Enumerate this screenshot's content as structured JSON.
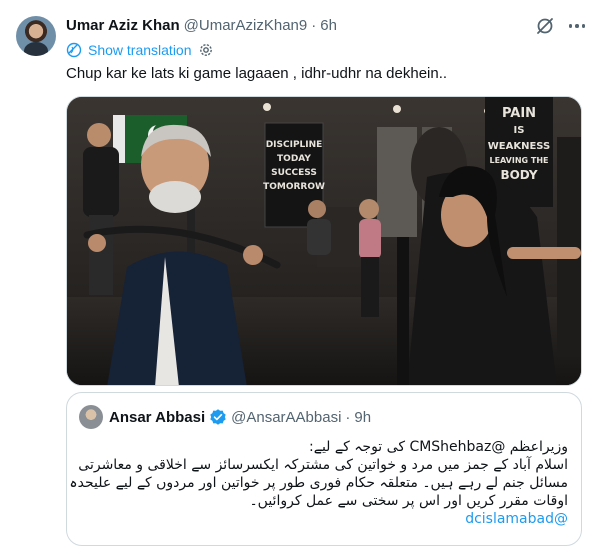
{
  "tweet": {
    "author_name": "Umar Aziz Khan",
    "author_handle": "@UmarAzizKhan9",
    "separator": "·",
    "time": "6h",
    "show_translation": "Show translation",
    "text": "Chup kar ke lats ki game lagaaen , idhr-udhr na dekhein.."
  },
  "media": {
    "sign_left": [
      "DISCIPLINE",
      "TODAY",
      "SUCCESS",
      "TOMORROW"
    ],
    "sign_right": [
      "PAIN",
      "IS",
      "WEAKNESS",
      "LEAVING THE",
      "BODY"
    ]
  },
  "quote": {
    "author_name": "Ansar Abbasi",
    "author_handle": "@AnsarAAbbasi",
    "separator": "·",
    "time": "9h",
    "lines": [
      "وزیراعظم @CMShehbaz کی توجہ کے لیے:",
      "اسلام آباد کے جمز میں مرد و خواتین کی مشترکہ ایکسرسائز سے اخلاقی و معاشرتی",
      "مسائل جنم لے رہے ہیں۔ متعلقہ حکام فوری طور پر خواتین اور مردوں کے لیے علیحدہ",
      "اوقات مقرر کریں اور اس پر سختی سے عمل کروائیں۔",
      "@dcislamabad"
    ]
  },
  "colors": {
    "accent": "#1d9bf0",
    "text": "#0f1419",
    "secondary": "#536471",
    "border": "#cfd9de"
  },
  "icons": {
    "grok": "grok-icon",
    "more": "more-icon",
    "translate": "translate-icon",
    "settings": "gear-icon",
    "verified": "verified-icon"
  }
}
